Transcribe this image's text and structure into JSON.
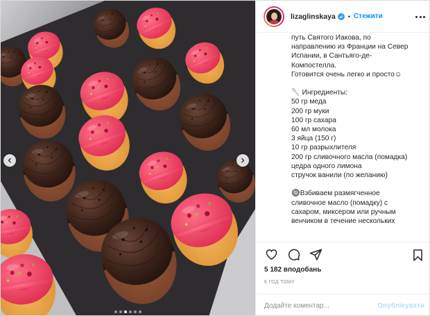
{
  "post": {
    "username": "lizaglinskaya",
    "separator": "•",
    "follow_label": "Стежити",
    "caption_lines": [
      "путь Святого Иакова, по",
      "направлению из Франции на Север",
      "Испании, в Сантьяго-де-",
      "Компостелла.",
      "Готовится очень легко и просто☺",
      "",
      "🥄 Ингредиенты:",
      "50 гр меда",
      "200 гр муки",
      "100 гр сахара",
      "60 мл молока",
      "3 яйца (150 г)",
      "10 гр разрыхлителя",
      "200 гр сливочного масла (помадка)",
      "цедра одного лимона",
      "стручок ванили (по желанию)",
      "",
      "🔘Взбиваем размягченное",
      "сливочное масло (помадку) с",
      "сахаром, миксером или ручным",
      "венчиком в течение нескольких"
    ],
    "likes": "5 182 вподобань",
    "time": "6 год тому",
    "comment_placeholder": "Додайте коментар...",
    "publish_label": "Опублікувати"
  },
  "icons": {
    "verified": "verified-badge-icon",
    "more": "more-options-icon",
    "like": "heart-icon",
    "comment": "comment-icon",
    "share": "share-icon",
    "save": "bookmark-icon",
    "prev": "chevron-left-icon",
    "next": "chevron-right-icon"
  },
  "carousel": {
    "count": 6,
    "active_index": 2
  },
  "colors": {
    "accent": "#0095f6",
    "publish_disabled": "#b3dffc",
    "text": "#262626",
    "muted": "#8e8e8e"
  }
}
